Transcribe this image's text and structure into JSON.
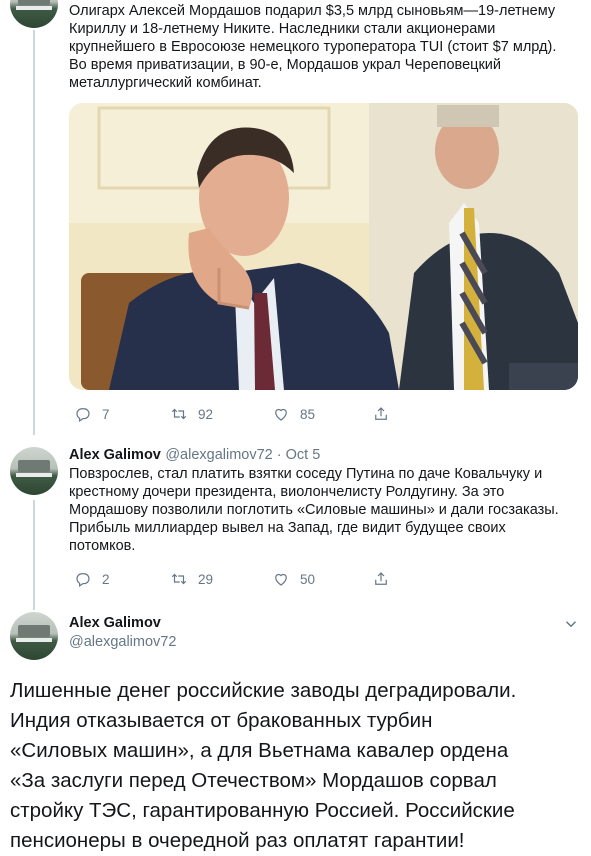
{
  "tweet1": {
    "text": "Олигарх Алексей Мордашов подарил $3,5 млрд сыновьям—19-летнему\nКириллу и 18-летнему Никите. Наследники стали акционерами\nкрупнейшего в Евросоюзе немецкого туроператора TUI (стоит $7 млрд).\nВо время приватизации, в 90-е, Мордашов украл Череповецкий\nметаллургический комбинат.",
    "replies": "7",
    "retweets": "92",
    "likes": "85"
  },
  "tweet2": {
    "name": "Alex Galimov",
    "handle": "@alexgalimov72 · Oct 5",
    "text": "Повзрослев, стал платить взятки соседу Путина по даче Ковальчуку и\nкрестному дочери президента, виолончелисту Ролдугину. За это\nМордашову позволили поглотить «Силовые машины» и дали госзаказы.\nПрибыль миллиардер вывел на Запад, где видит будущее своих\nпотомков.",
    "replies": "2",
    "retweets": "29",
    "likes": "50"
  },
  "tweet3": {
    "name": "Alex Galimov",
    "handle": "@alexgalimov72",
    "text": "Лишенные денег российские заводы деградировали.\nИндия отказывается от бракованных турбин\n«Силовых машин», а для Вьетнама кавалер ордена\n«За заслуги перед Отечеством» Мордашов сорвал\nстройку ТЭС, гарантированную Россией. Российские\nпенсионеры в очередной раз оплатят гарантии!"
  },
  "icons": [
    "reply-icon",
    "retweet-icon",
    "like-icon",
    "share-icon",
    "chevron-down-icon"
  ],
  "colors": {
    "text": "#14171a",
    "muted": "#657786",
    "divider": "#e6ecf0",
    "thread": "#ccd6dd"
  }
}
